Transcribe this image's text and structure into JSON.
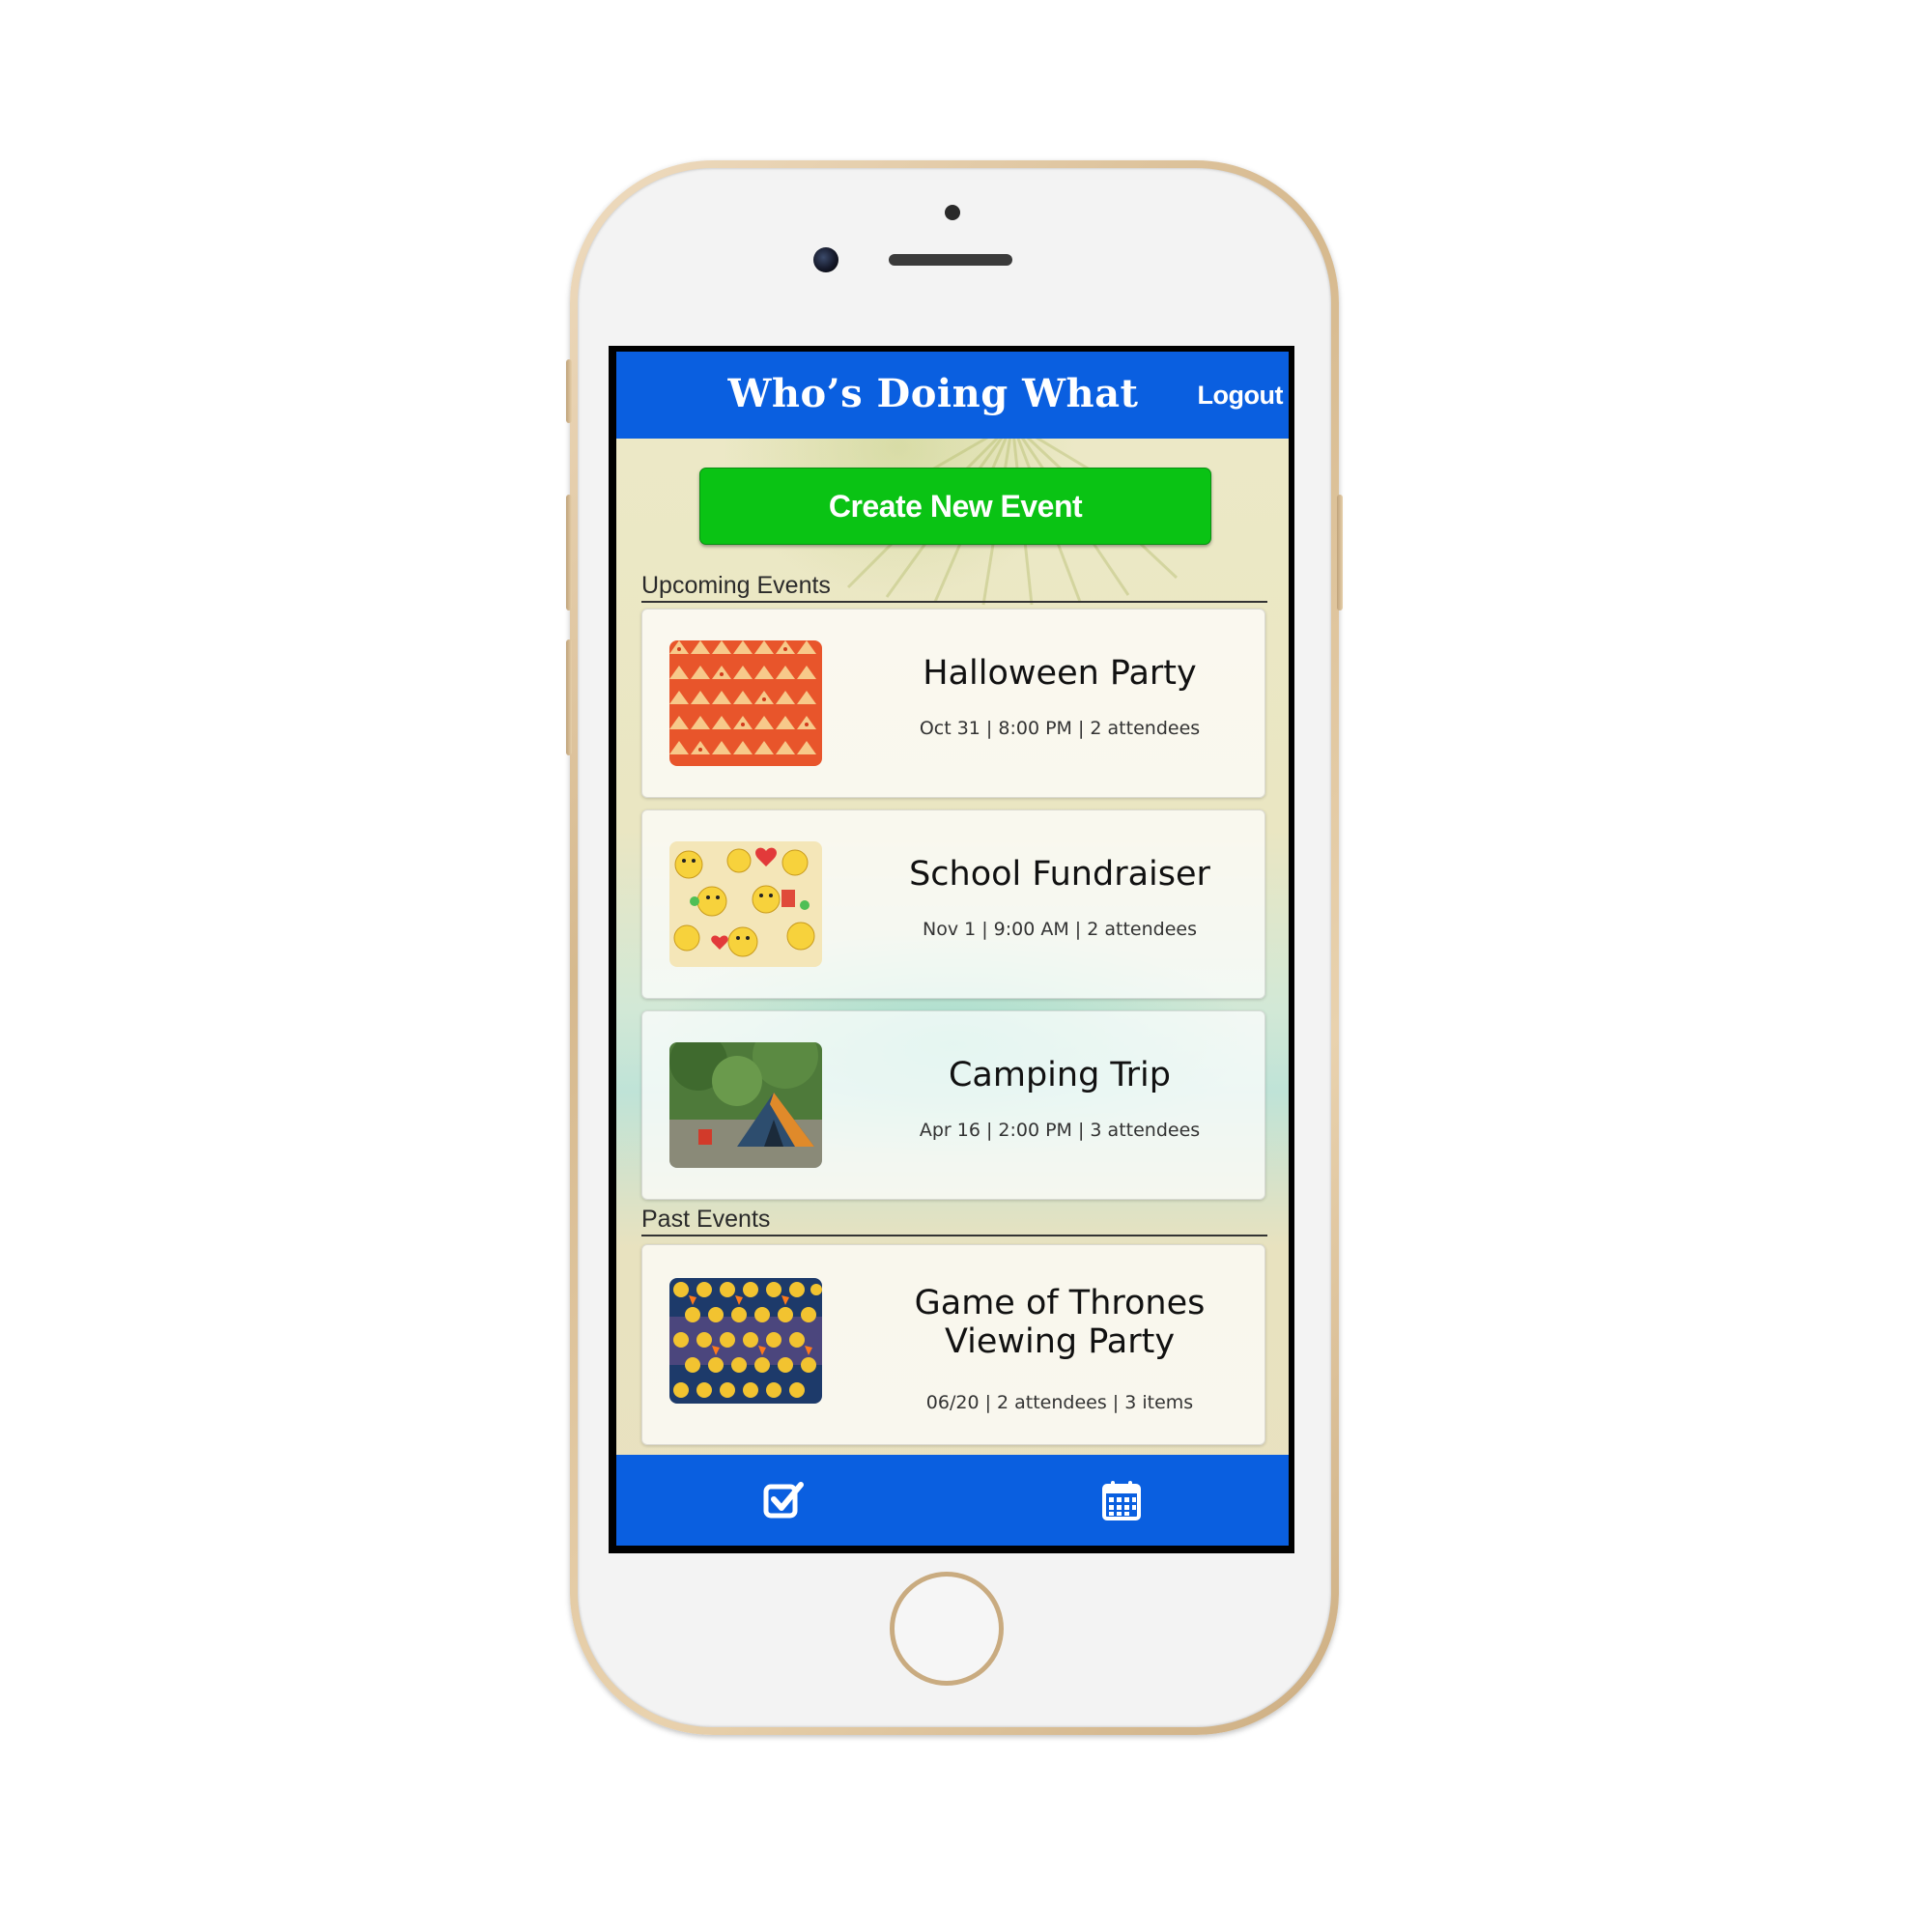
{
  "header": {
    "title": "Who’s Doing What",
    "logout_label": "Logout"
  },
  "actions": {
    "create_label": "Create New Event"
  },
  "sections": {
    "upcoming_label": "Upcoming Events",
    "past_label": "Past Events"
  },
  "events": {
    "upcoming": [
      {
        "title": "Halloween Party",
        "meta": "Oct 31 | 8:00 PM | 2 attendees",
        "thumbnail": "pizza-pattern"
      },
      {
        "title": "School Fundraiser",
        "meta": "Nov 1 | 9:00 AM | 2 attendees",
        "thumbnail": "emoji-collage"
      },
      {
        "title": "Camping Trip",
        "meta": "Apr 16 | 2:00 PM | 3 attendees",
        "thumbnail": "tent-photo"
      }
    ],
    "past": [
      {
        "title_line1": "Game of Thrones",
        "title_line2": "Viewing Party",
        "meta": "06/20 | 2 attendees | 3 items",
        "thumbnail": "emoji-grid"
      }
    ]
  },
  "tabbar": {
    "tabs": [
      {
        "icon": "checkbox-icon"
      },
      {
        "icon": "calendar-icon"
      }
    ]
  },
  "colors": {
    "brand_blue": "#0a5fe0",
    "create_green": "#0ac314"
  }
}
